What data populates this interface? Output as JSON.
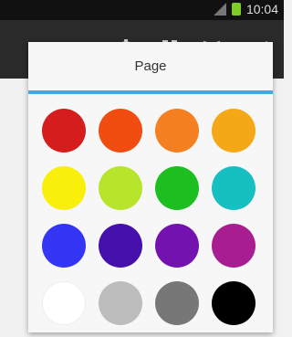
{
  "status_bar": {
    "time": "10:04"
  },
  "toolbar": {
    "icons": [
      "timer-icon",
      "grid-icon",
      "book-icon",
      "overflow-menu-icon"
    ]
  },
  "popup": {
    "title": "Page",
    "accent_color": "#4aa7dd",
    "colors": [
      "#d51d1d",
      "#f14d10",
      "#f48021",
      "#f4a817",
      "#f8f00b",
      "#b6e52c",
      "#1cbf1f",
      "#16bfc0",
      "#3535f5",
      "#4610ad",
      "#7412b0",
      "#a81d8f",
      "#ffffff",
      "#bdbdbd",
      "#777777",
      "#000000"
    ]
  }
}
